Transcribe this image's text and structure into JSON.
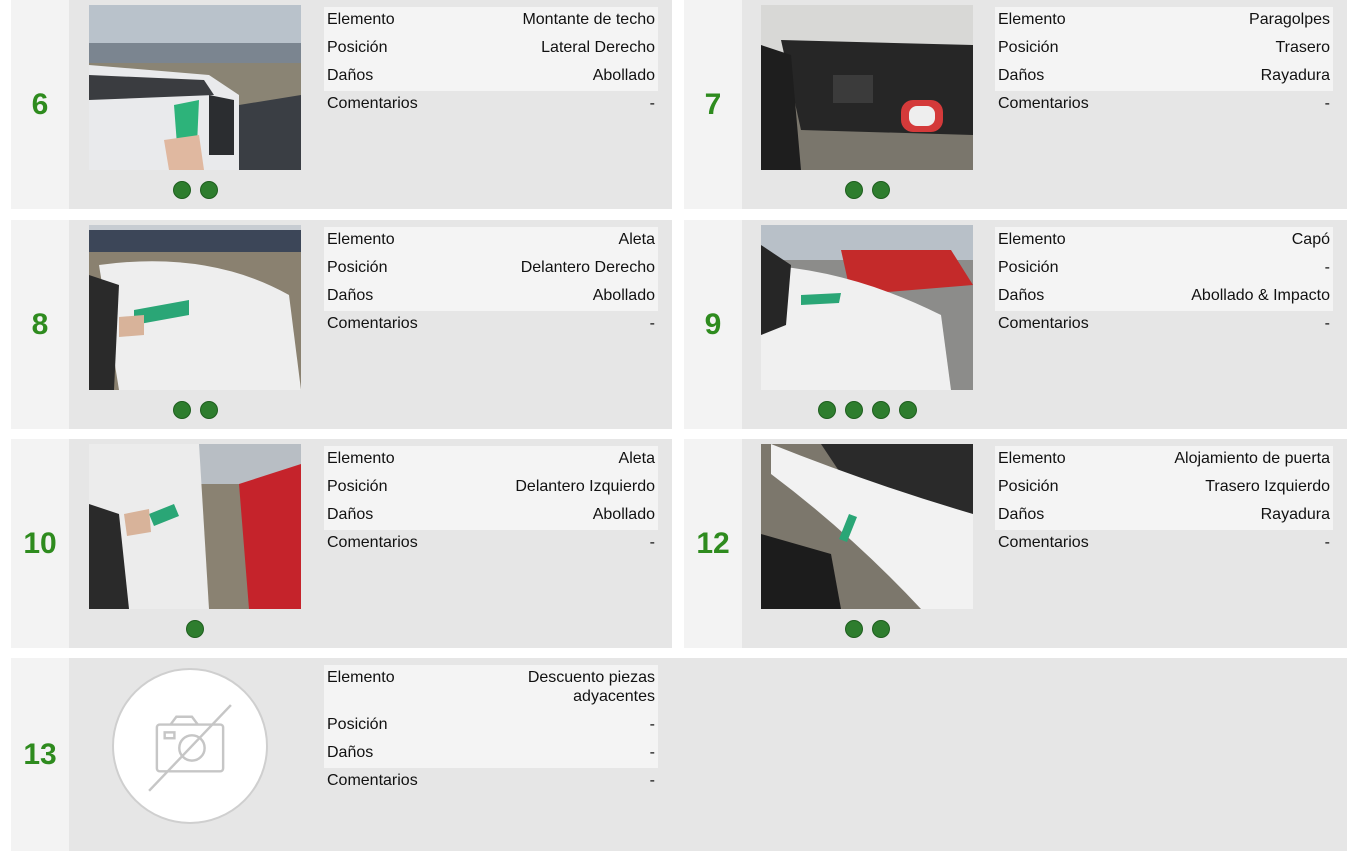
{
  "labels": {
    "element": "Elemento",
    "position": "Posición",
    "damage": "Daños",
    "comments": "Comentarios"
  },
  "damages": [
    {
      "number": "6",
      "element": "Montante de techo",
      "position": "Lateral Derecho",
      "damage": "Abollado",
      "comments": "-",
      "photo_count": 2
    },
    {
      "number": "7",
      "element": "Paragolpes",
      "position": "Trasero",
      "damage": "Rayadura",
      "comments": "-",
      "photo_count": 2
    },
    {
      "number": "8",
      "element": "Aleta",
      "position": "Delantero Derecho",
      "damage": "Abollado",
      "comments": "-",
      "photo_count": 2
    },
    {
      "number": "9",
      "element": "Capó",
      "position": "-",
      "damage": "Abollado & Impacto",
      "comments": "-",
      "photo_count": 4
    },
    {
      "number": "10",
      "element": "Aleta",
      "position": "Delantero Izquierdo",
      "damage": "Abollado",
      "comments": "-",
      "photo_count": 1
    },
    {
      "number": "12",
      "element": "Alojamiento de puerta",
      "position": "Trasero Izquierdo",
      "damage": "Rayadura",
      "comments": "-",
      "photo_count": 2
    },
    {
      "number": "13",
      "element": "Descuento piezas adyacentes",
      "position": "-",
      "damage": "-",
      "comments": "-",
      "photo_count": 0
    }
  ],
  "colors": {
    "accent_green": "#2e8b1e",
    "dot_green": "#2e7d2e",
    "card_bg": "#e6e6e6",
    "number_bg": "#f3f3f3"
  },
  "icons": {
    "no_photo": "camera-slash-icon",
    "gallery_dot": "photo-indicator-dot"
  }
}
